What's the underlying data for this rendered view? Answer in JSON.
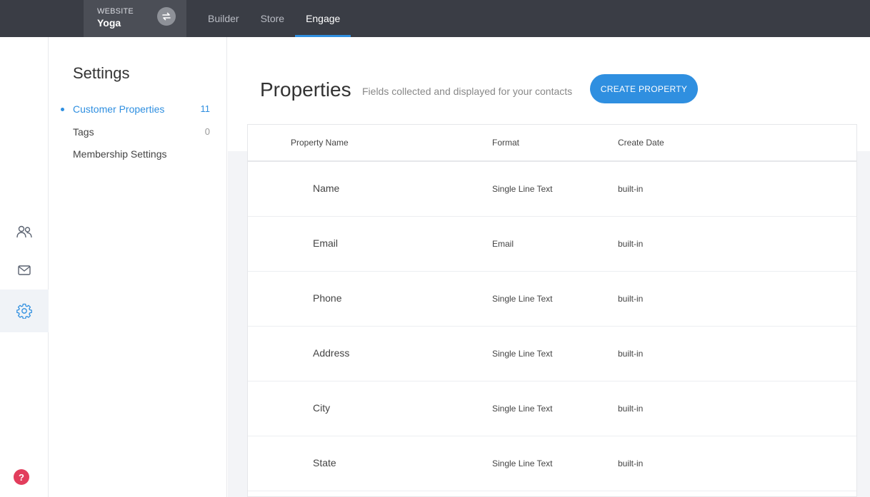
{
  "topbar": {
    "site_label": "WEBSITE",
    "site_name": "Yoga",
    "nav": [
      {
        "label": "Builder",
        "active": false
      },
      {
        "label": "Store",
        "active": false
      },
      {
        "label": "Engage",
        "active": true
      }
    ]
  },
  "rail": {
    "items": [
      {
        "icon": "contacts-icon",
        "active": false
      },
      {
        "icon": "mail-icon",
        "active": false
      },
      {
        "icon": "gear-icon",
        "active": true
      }
    ],
    "help_label": "?"
  },
  "settings": {
    "title": "Settings",
    "items": [
      {
        "label": "Customer Properties",
        "count": "11",
        "active": true
      },
      {
        "label": "Tags",
        "count": "0",
        "active": false
      },
      {
        "label": "Membership Settings",
        "count": "",
        "active": false
      }
    ]
  },
  "main": {
    "title": "Properties",
    "subtitle": "Fields collected and displayed for your contacts",
    "create_button": "CREATE PROPERTY",
    "table": {
      "columns": [
        "Property Name",
        "Format",
        "Create Date"
      ],
      "rows": [
        {
          "name": "Name",
          "format": "Single Line Text",
          "date": "built-in"
        },
        {
          "name": "Email",
          "format": "Email",
          "date": "built-in"
        },
        {
          "name": "Phone",
          "format": "Single Line Text",
          "date": "built-in"
        },
        {
          "name": "Address",
          "format": "Single Line Text",
          "date": "built-in"
        },
        {
          "name": "City",
          "format": "Single Line Text",
          "date": "built-in"
        },
        {
          "name": "State",
          "format": "Single Line Text",
          "date": "built-in"
        }
      ]
    }
  },
  "colors": {
    "accent": "#2f8fe0",
    "topbar": "#3a3d45",
    "help": "#e23d5c"
  }
}
